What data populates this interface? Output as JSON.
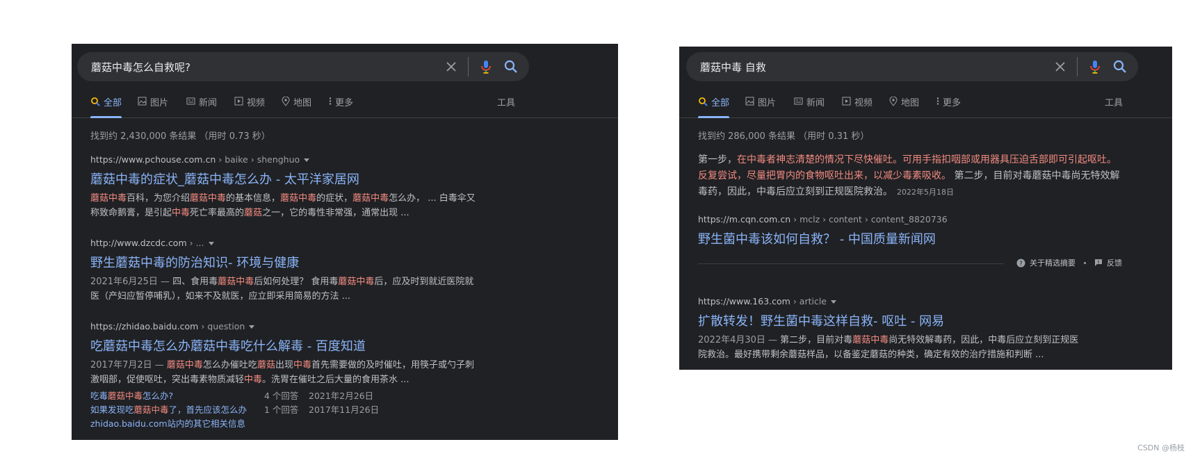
{
  "left": {
    "query": "蘑菇中毒怎么自救呢?",
    "tabs": [
      "全部",
      "图片",
      "新闻",
      "视频",
      "地图",
      "更多"
    ],
    "tools": "工具",
    "stats": "找到约 2,430,000 条结果 （用时 0.73 秒）",
    "results": [
      {
        "domain": "https://www.pchouse.com.cn",
        "path": " › baike › shenghuo",
        "title": "蘑菇中毒的症状_蘑菇中毒怎么办 - 太平洋家居网",
        "snippet": [
          {
            "t": "蘑菇中毒",
            "h": true
          },
          {
            "t": "百科，为您介绍"
          },
          {
            "t": "蘑菇中毒",
            "h": true
          },
          {
            "t": "的基本信息，"
          },
          {
            "t": "蘑菇中毒",
            "h": true
          },
          {
            "t": "的症状，"
          },
          {
            "t": "蘑菇中毒",
            "h": true
          },
          {
            "t": "怎么办， ... 白毒伞又称致命鹅膏，是引起"
          },
          {
            "t": "中毒",
            "h": true
          },
          {
            "t": "死亡率最高的"
          },
          {
            "t": "蘑菇",
            "h": true
          },
          {
            "t": "之一，它的毒性非常强，通常出现 ..."
          }
        ]
      },
      {
        "domain": "http://www.dzcdc.com",
        "path": " › ...",
        "title": "野生蘑菇中毒的防治知识- 环境与健康",
        "snippet": [
          {
            "t": "2021年6月25日 — ",
            "d": true
          },
          {
            "t": "四、食用毒"
          },
          {
            "t": "蘑菇中毒",
            "h": true
          },
          {
            "t": "后如何处理？ 食用毒"
          },
          {
            "t": "蘑菇中毒",
            "h": true
          },
          {
            "t": "后，应及时到就近医院就医（产妇应暂停哺乳），如来不及就医，应立即采用简易的方法 ..."
          }
        ]
      },
      {
        "domain": "https://zhidao.baidu.com",
        "path": " › question",
        "title": "吃蘑菇中毒怎么办蘑菇中毒吃什么解毒 - 百度知道",
        "snippet": [
          {
            "t": "2017年7月2日 — ",
            "d": true
          },
          {
            "t": "蘑菇中毒",
            "h": true
          },
          {
            "t": "怎么办催吐吃"
          },
          {
            "t": "蘑菇",
            "h": true
          },
          {
            "t": "出现"
          },
          {
            "t": "中毒",
            "h": true
          },
          {
            "t": "首先需要做的及时催吐，用筷子或勺子刺激咽部，促使呕吐，突出毒素物质减轻"
          },
          {
            "t": "中毒",
            "h": true
          },
          {
            "t": "。洗胃在催吐之后大量的食用茶水 ..."
          }
        ],
        "related": [
          {
            "q": [
              {
                "t": "吃毒"
              },
              {
                "t": "蘑菇中毒",
                "h": true
              },
              {
                "t": "怎么办?"
              }
            ],
            "answers": "4 个回答",
            "date": "2021年2月26日"
          },
          {
            "q": [
              {
                "t": "如果发现吃"
              },
              {
                "t": "蘑菇中毒",
                "h": true
              },
              {
                "t": "了，首先应该怎么办"
              }
            ],
            "answers": "1 个回答",
            "date": "2017年11月26日"
          }
        ],
        "more": "zhidao.baidu.com站内的其它相关信息"
      }
    ]
  },
  "right": {
    "query": "蘑菇中毒  自救",
    "tabs": [
      "全部",
      "图片",
      "新闻",
      "视频",
      "地图",
      "更多"
    ],
    "tools": "工具",
    "stats": "找到约 286,000 条结果 （用时 0.31 秒）",
    "featured": [
      {
        "t": "第一步，"
      },
      {
        "t": "在中毒者神志清楚的情况下尽快催吐。可用手指扣咽部或用器具压迫舌部即可引起呕吐。反复尝试，尽量把胃内的食物呕吐出来，以减少毒素吸收。",
        "h": true
      },
      {
        "t": " 第二步，目前对毒蘑菇中毒尚无特效解毒药，因此，中毒后应立刻到正规医院救治。"
      }
    ],
    "featured_date": "2022年5月18日",
    "featured_source": {
      "domain": "https://m.cqn.com.cn",
      "path": " › mclz › content › content_8820736",
      "title": "野生菌中毒该如何自救？ - 中国质量新闻网"
    },
    "about_label": "关于精选摘要",
    "feedback_label": "反馈",
    "result": {
      "domain": "https://www.163.com",
      "path": " › article",
      "title": "扩散转发！野生菌中毒这样自救- 呕吐 - 网易",
      "snippet": [
        {
          "t": "2022年4月30日 — ",
          "d": true
        },
        {
          "t": "第二步，目前对毒"
        },
        {
          "t": "蘑菇中毒",
          "h": true
        },
        {
          "t": "尚无特效解毒药，因此，中毒后应立刻到正规医院救治。最好携带剩余蘑菇样品，以备鉴定蘑菇的种类，确定有效的治疗措施和判断 ..."
        }
      ]
    }
  },
  "watermark": "CSDN @杨枝"
}
